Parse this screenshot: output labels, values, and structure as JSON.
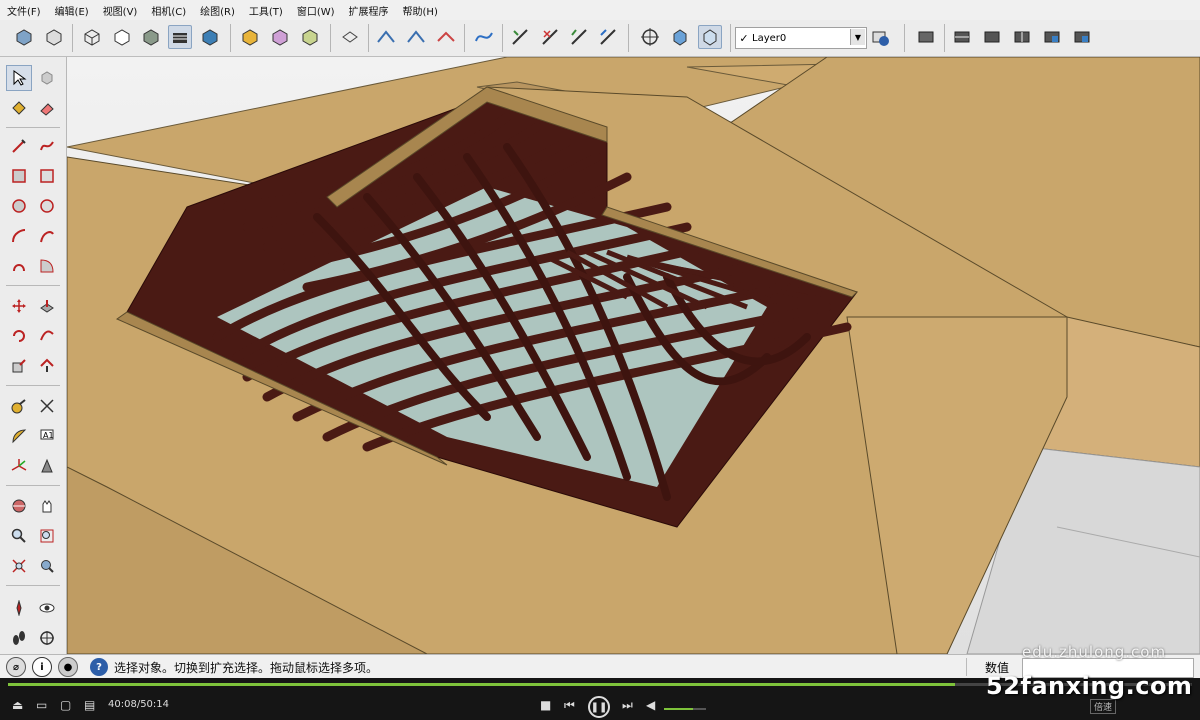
{
  "menu": [
    "文件(F)",
    "编辑(E)",
    "视图(V)",
    "相机(C)",
    "绘图(R)",
    "工具(T)",
    "窗口(W)",
    "扩展程序",
    "帮助(H)"
  ],
  "layer": {
    "check": "✓",
    "name": "Layer0"
  },
  "status": {
    "message": "选择对象。切换到扩充选择。拖动鼠标选择多项。",
    "measure_label": "数值"
  },
  "player": {
    "time": "40:08/50:14",
    "speed": "倍速",
    "progress": 0.8
  },
  "watermarks": {
    "site": "edu.zhulong.com",
    "brand": "52fanxing.com"
  },
  "colors": {
    "ground": "#c9a66b",
    "beam": "#4a1a14",
    "glass": "#b8d8d2",
    "toolbar": "#ececec"
  }
}
